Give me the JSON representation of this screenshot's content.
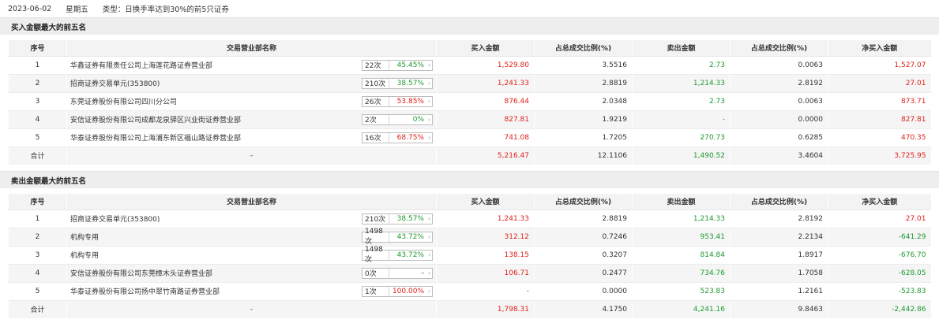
{
  "header": {
    "date": "2023-06-02",
    "weekday": "星期五",
    "type_label": "类型：日换手率达到30%的前5只证券"
  },
  "columns": [
    "序号",
    "交易营业部名称",
    "买入金额",
    "占总成交比例(%)",
    "卖出金额",
    "占总成交比例(%)",
    "净买入金额"
  ],
  "buy_section": {
    "title": "买入金额最大的前五名",
    "rows": [
      {
        "idx": "1",
        "name": "华鑫证券有限责任公司上海莲花路证券营业部",
        "count": "22次",
        "pct": "45.45%",
        "pct_color": "green",
        "buy": "1,529.80",
        "buy_ratio": "3.5516",
        "sell": "2.73",
        "sell_ratio": "0.0063",
        "net": "1,527.07",
        "net_color": "red"
      },
      {
        "idx": "2",
        "name": "招商证券交易单元(353800)",
        "count": "210次",
        "pct": "38.57%",
        "pct_color": "green",
        "buy": "1,241.33",
        "buy_ratio": "2.8819",
        "sell": "1,214.33",
        "sell_ratio": "2.8192",
        "net": "27.01",
        "net_color": "red"
      },
      {
        "idx": "3",
        "name": "东莞证券股份有限公司四川分公司",
        "count": "26次",
        "pct": "53.85%",
        "pct_color": "red",
        "buy": "876.44",
        "buy_ratio": "2.0348",
        "sell": "2.73",
        "sell_ratio": "0.0063",
        "net": "873.71",
        "net_color": "red"
      },
      {
        "idx": "4",
        "name": "安信证券股份有限公司成都龙泉驿区兴业街证券营业部",
        "count": "2次",
        "pct": "0%",
        "pct_color": "green",
        "buy": "827.81",
        "buy_ratio": "1.9219",
        "sell": "-",
        "sell_ratio": "0.0000",
        "net": "827.81",
        "net_color": "red"
      },
      {
        "idx": "5",
        "name": "华泰证券股份有限公司上海浦东新区福山路证券营业部",
        "count": "16次",
        "pct": "68.75%",
        "pct_color": "red",
        "buy": "741.08",
        "buy_ratio": "1.7205",
        "sell": "270.73",
        "sell_ratio": "0.6285",
        "net": "470.35",
        "net_color": "red"
      }
    ],
    "total": {
      "label": "合计",
      "name": "-",
      "buy": "5,216.47",
      "buy_ratio": "12.1106",
      "sell": "1,490.52",
      "sell_ratio": "3.4604",
      "net": "3,725.95"
    }
  },
  "sell_section": {
    "title": "卖出金额最大的前五名",
    "rows": [
      {
        "idx": "1",
        "name": "招商证券交易单元(353800)",
        "count": "210次",
        "pct": "38.57%",
        "pct_color": "green",
        "buy": "1,241.33",
        "buy_ratio": "2.8819",
        "sell": "1,214.33",
        "sell_ratio": "2.8192",
        "net": "27.01",
        "net_color": "red"
      },
      {
        "idx": "2",
        "name": "机构专用",
        "count": "1498次",
        "pct": "43.72%",
        "pct_color": "green",
        "buy": "312.12",
        "buy_ratio": "0.7246",
        "sell": "953.41",
        "sell_ratio": "2.2134",
        "net": "-641.29",
        "net_color": "green"
      },
      {
        "idx": "3",
        "name": "机构专用",
        "count": "1498次",
        "pct": "43.72%",
        "pct_color": "green",
        "buy": "138.15",
        "buy_ratio": "0.3207",
        "sell": "814.84",
        "sell_ratio": "1.8917",
        "net": "-676.70",
        "net_color": "green"
      },
      {
        "idx": "4",
        "name": "安信证券股份有限公司东莞樟木头证券营业部",
        "count": "0次",
        "pct": "-",
        "pct_color": "dark",
        "buy": "106.71",
        "buy_ratio": "0.2477",
        "sell": "734.76",
        "sell_ratio": "1.7058",
        "net": "-628.05",
        "net_color": "green"
      },
      {
        "idx": "5",
        "name": "华泰证券股份有限公司扬中翠竹南路证券营业部",
        "count": "1次",
        "pct": "100.00%",
        "pct_color": "red",
        "buy": "-",
        "buy_ratio": "0.0000",
        "sell": "523.83",
        "sell_ratio": "1.2161",
        "net": "-523.83",
        "net_color": "green"
      }
    ],
    "total": {
      "label": "合计",
      "name": "-",
      "buy": "1,798.31",
      "buy_ratio": "4.1750",
      "sell": "4,241.16",
      "sell_ratio": "9.8463",
      "net": "-2,442.86"
    }
  }
}
